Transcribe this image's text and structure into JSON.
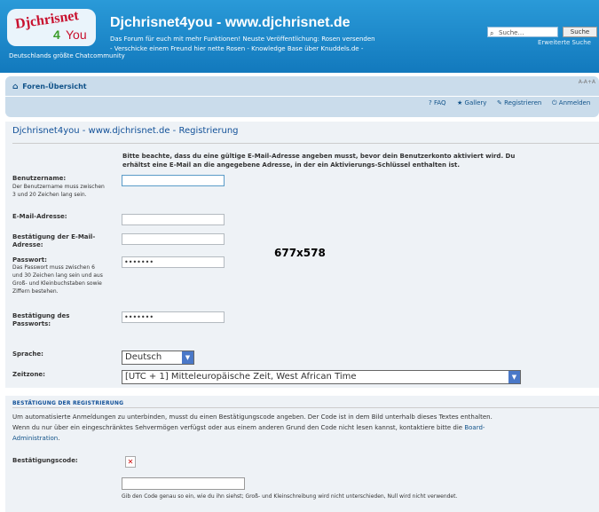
{
  "header": {
    "logo": {
      "line1": "Djchrisnet",
      "line2a": "4",
      "line2b": "You"
    },
    "title": "Djchrisnet4you - www.djchrisnet.de",
    "description": "Das Forum für euch mit mehr Funktionen! Neuste Veröffentlichung: Rosen versenden - Verschicke einem Freund hier nette Rosen - Knowledge Base über Knuddels.de -",
    "description2": "Deutschlands größte Chatcommunity",
    "search": {
      "placeholder": "Suche…",
      "button": "Suche",
      "advanced": "Erweiterte Suche"
    }
  },
  "nav": {
    "index": "Foren-Übersicht",
    "font_size": "A-A+A",
    "links": [
      {
        "icon": "?",
        "label": "FAQ"
      },
      {
        "icon": "★",
        "label": "Gallery"
      },
      {
        "icon": "✎",
        "label": "Registrieren"
      },
      {
        "icon": "⏻",
        "label": "Anmelden"
      }
    ]
  },
  "form": {
    "title": "Djchrisnet4you - www.djchrisnet.de - Registrierung",
    "notice": "Bitte beachte, dass du eine gültige E-Mail-Adresse angeben musst, bevor dein Benutzerkonto aktiviert wird. Du erhältst eine E-Mail an die angegebene Adresse, in der ein Aktivierungs-Schlüssel enthalten ist.",
    "username": {
      "label": "Benutzername:",
      "explain": "Der Benutzername muss zwischen 3 und 20 Zeichen lang sein.",
      "value": ""
    },
    "email": {
      "label": "E-Mail-Adresse:",
      "value": ""
    },
    "email_confirm": {
      "label": "Bestätigung der E-Mail-Adresse:",
      "value": ""
    },
    "password": {
      "label": "Passwort:",
      "explain": "Das Passwort muss zwischen 6 und 30 Zeichen lang sein und aus Groß- und Kleinbuchstaben sowie Ziffern bestehen.",
      "value": "•••••••"
    },
    "password_confirm": {
      "label": "Bestätigung des Passworts:",
      "value": "•••••••"
    },
    "language": {
      "label": "Sprache:",
      "selected": "Deutsch"
    },
    "timezone": {
      "label": "Zeitzone:",
      "selected": "[UTC + 1] Mitteleuropäische Zeit, West African Time"
    }
  },
  "overlay": "677x578",
  "confirmation": {
    "heading": "BESTÄTIGUNG DER REGISTRIERUNG",
    "text": "Um automatisierte Anmeldungen zu unterbinden, musst du einen Bestätigungscode angeben. Der Code ist in dem Bild unterhalb dieses Textes enthalten. Wenn du nur über ein eingeschränktes Sehvermögen verfügst oder aus einem anderen Grund den Code nicht lesen kannst, kontaktiere bitte die",
    "link": "Board-Administration",
    "link_suffix": ".",
    "label": "Bestätigungscode:",
    "explain": "Gib den Code genau so ein, wie du ihn siehst; Groß- und Kleinschreibung wird nicht unterschieden, Null wird nicht verwendet."
  }
}
